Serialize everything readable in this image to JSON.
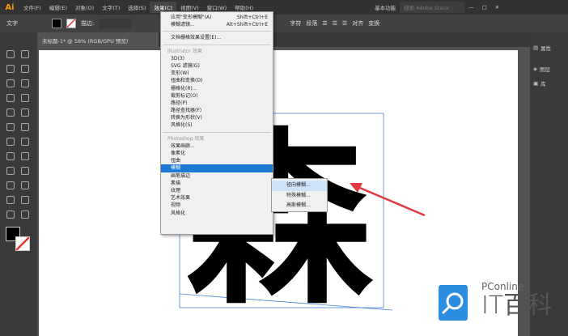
{
  "app": {
    "logo": "Ai"
  },
  "menubar": [
    "文件(F)",
    "编辑(E)",
    "对象(O)",
    "文字(T)",
    "选择(S)",
    "效果(C)",
    "视图(V)",
    "窗口(W)",
    "帮助(H)"
  ],
  "workspace": "基本功能",
  "search_placeholder": "搜索 Adobe Stock",
  "control": {
    "label": "文字",
    "stroke": "描边:",
    "char": "字符",
    "para": "段落",
    "align": "对齐",
    "transform": "变换"
  },
  "doc_tab": "未标题-1* @ 56% (RGB/GPU 预览)",
  "right_panel": [
    "属性",
    "图层",
    "库"
  ],
  "effect_menu": {
    "top": [
      {
        "label": "应用\"变形模糊\"(A)",
        "shortcut": "Shift+Ctrl+E"
      },
      {
        "label": "模糊滤镜...",
        "shortcut": "Alt+Shift+Ctrl+E"
      }
    ],
    "doc_raster": "文档栅格效果设置(E)...",
    "illustrator_header": "Illustrator 效果",
    "illustrator": [
      "3D(3)",
      "SVG 滤镜(G)",
      "变形(W)",
      "扭曲和变换(D)",
      "栅格化(R)...",
      "裁剪标记(O)",
      "路径(P)",
      "路径查找器(F)",
      "转换为形状(V)",
      "风格化(S)"
    ],
    "photoshop_header": "Photoshop 效果",
    "photoshop": [
      "效果画廊...",
      "像素化",
      "扭曲",
      "模糊",
      "画笔描边",
      "素描",
      "纹理",
      "艺术效果",
      "视频",
      "风格化"
    ],
    "highlighted": "模糊"
  },
  "submenu": [
    "径向模糊...",
    "特殊模糊...",
    "高斯模糊..."
  ],
  "canvas_text": "森",
  "watermark": {
    "brand": "PConline",
    "name": "IT百科"
  },
  "colors": {
    "highlight": "#1e78d6",
    "arrow": "#e0393e",
    "logo": "#2b8ee0"
  }
}
